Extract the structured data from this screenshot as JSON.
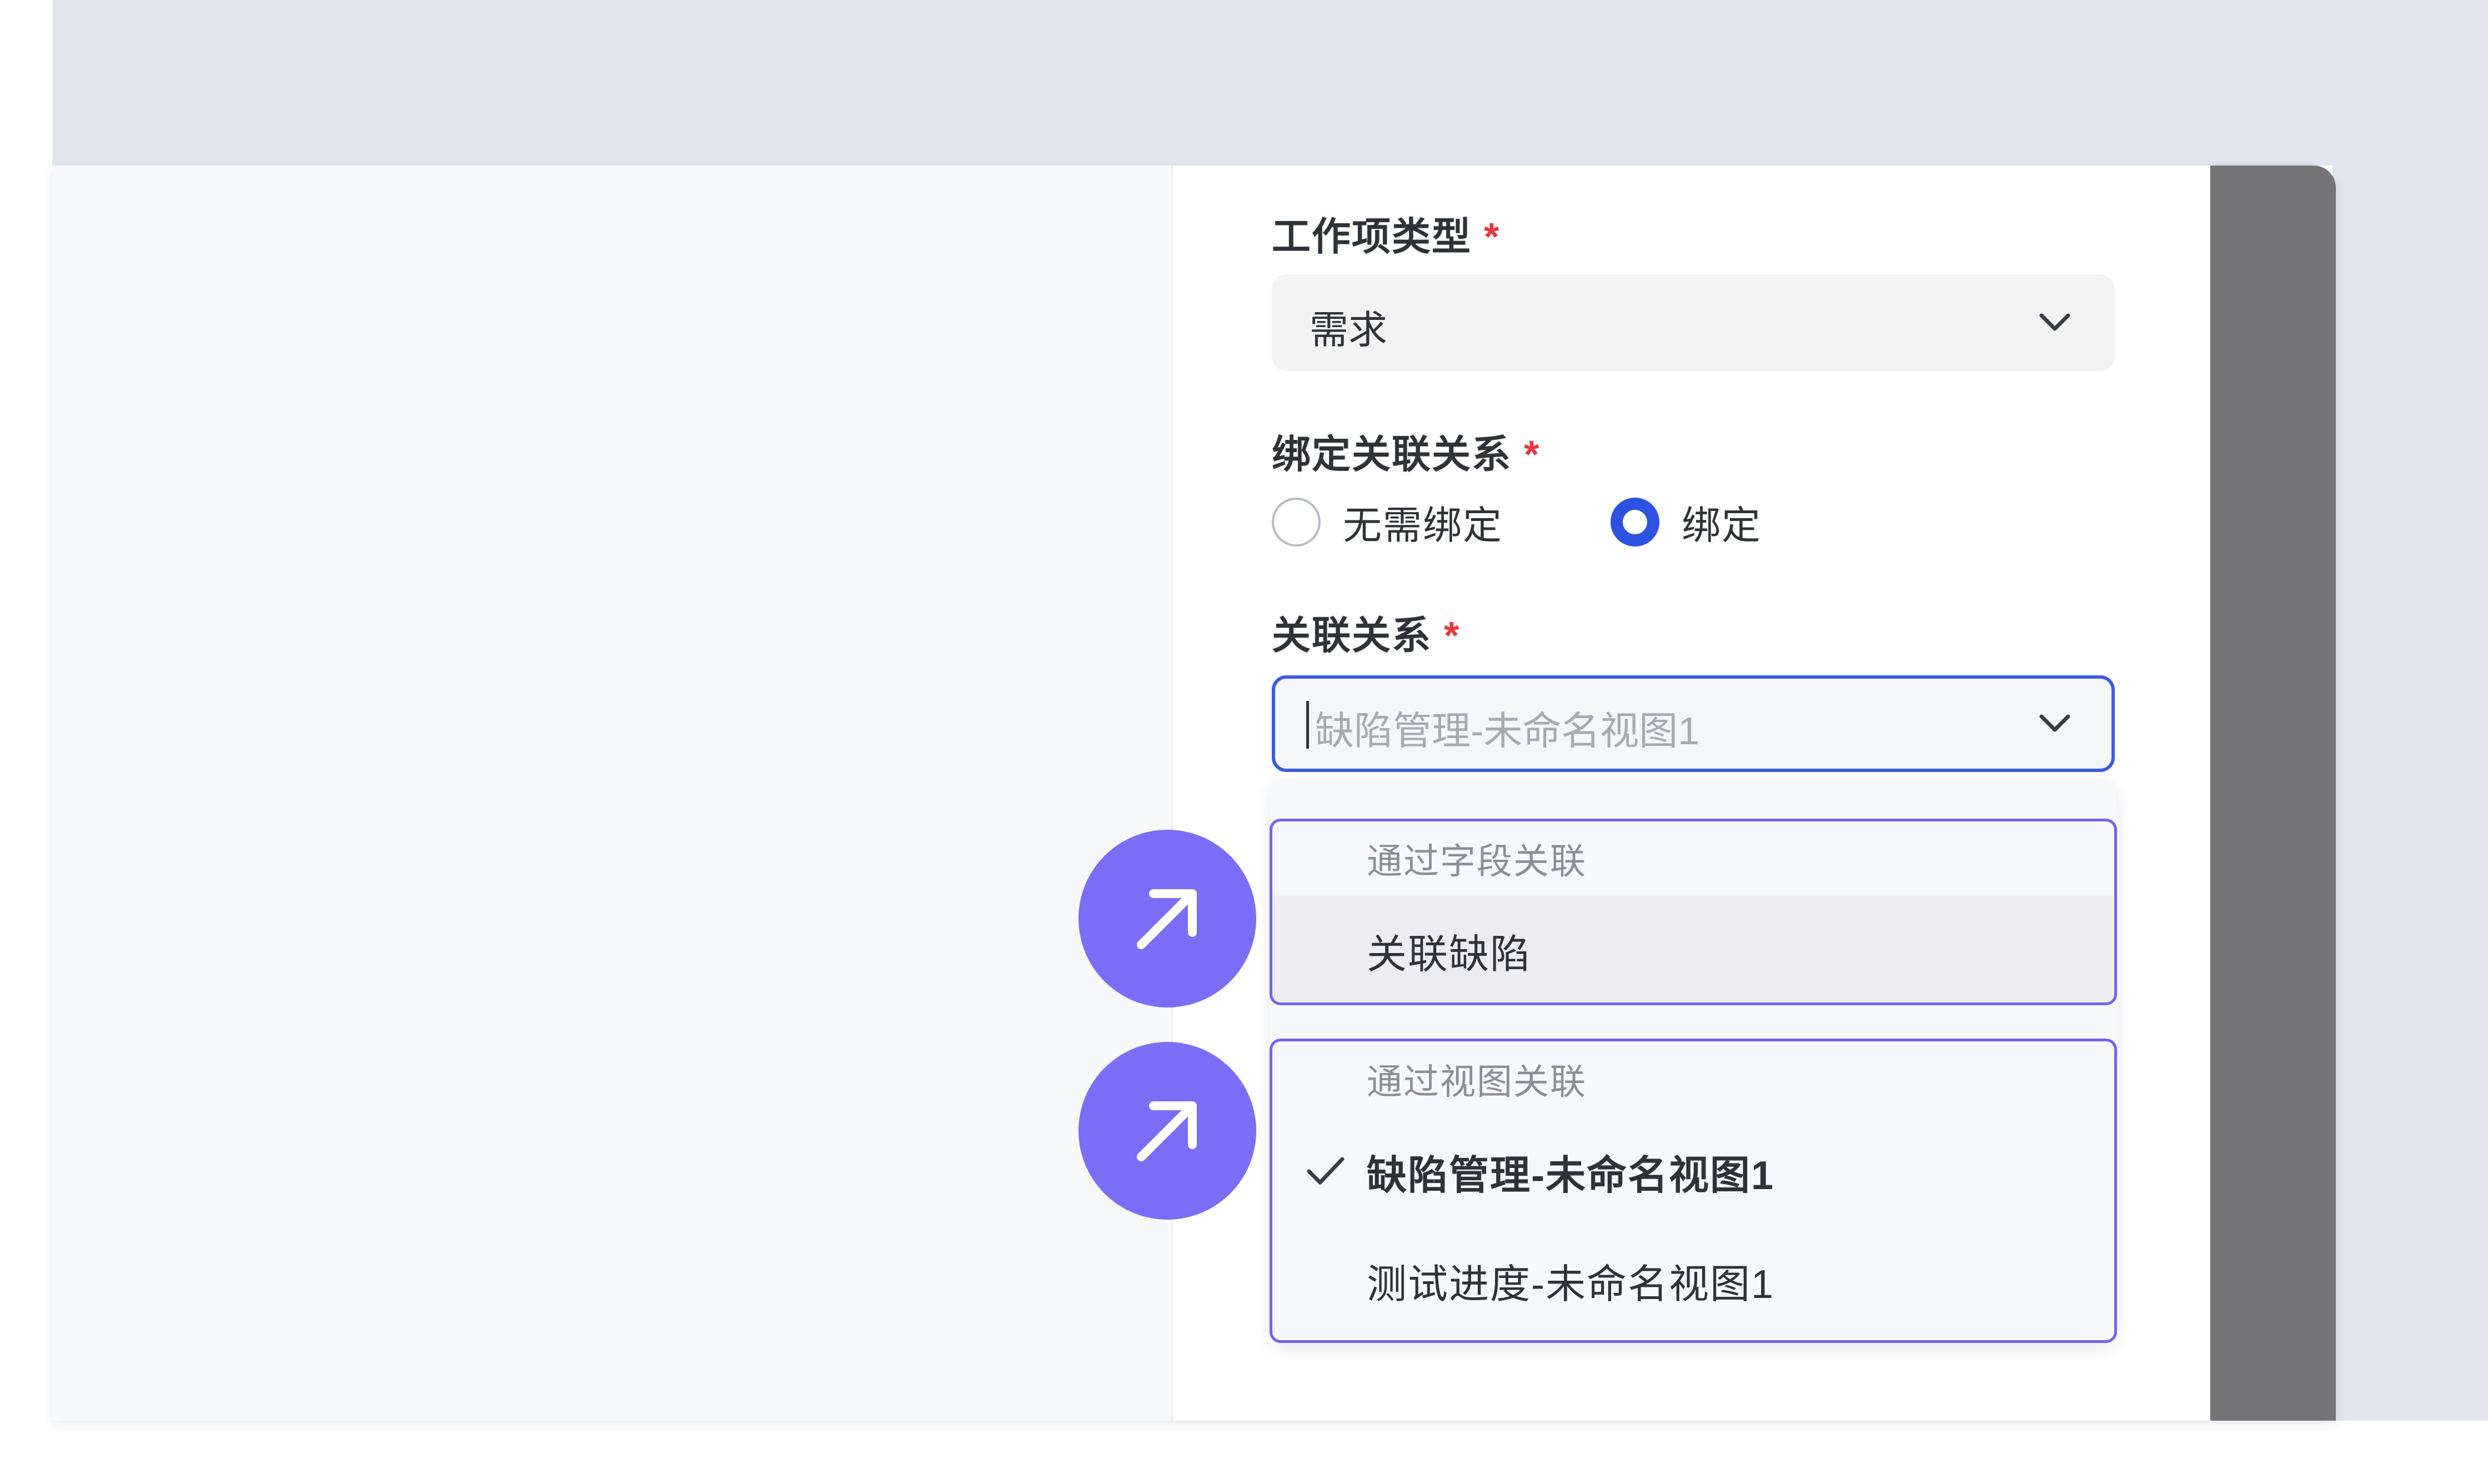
{
  "form": {
    "work_item_type": {
      "label": "工作项类型",
      "required_mark": "*",
      "value": "需求"
    },
    "binding": {
      "label": "绑定关联关系",
      "required_mark": "*",
      "options": [
        {
          "label": "无需绑定",
          "checked": false
        },
        {
          "label": "绑定",
          "checked": true
        }
      ]
    },
    "relation": {
      "label": "关联关系",
      "required_mark": "*",
      "placeholder": "缺陷管理-未命名视图1"
    }
  },
  "dropdown": {
    "groups": [
      {
        "header": "通过字段关联",
        "options": [
          {
            "label": "关联缺陷",
            "selected": false,
            "hovered": true
          }
        ]
      },
      {
        "header": "通过视图关联",
        "options": [
          {
            "label": "缺陷管理-未命名视图1",
            "selected": true
          },
          {
            "label": "测试进度-未命名视图1",
            "selected": false
          }
        ]
      }
    ]
  },
  "icons": {
    "chevron": "chevron-down-icon",
    "check": "check-icon",
    "badge": "arrow-up-right-icon"
  },
  "colors": {
    "primary": "#2b52e0",
    "badge": "#7b6ef6",
    "required": "#e5373d",
    "highlight_border": "#7463ee"
  }
}
